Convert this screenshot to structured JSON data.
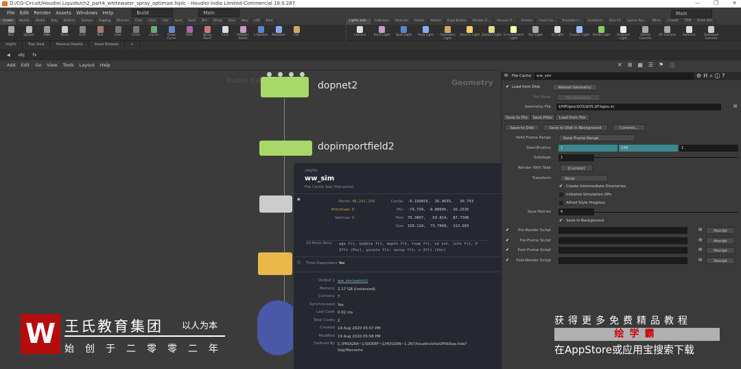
{
  "title": "D:/CG-Circuit/Houdini Liquids/ch2_part4_whitewater_spray_optimize.hiplc - Houdini Indie Limited-Commercial 18.0.287",
  "window_controls": [
    "—",
    "❐",
    "✕"
  ],
  "menu": [
    "File",
    "Edit",
    "Render",
    "Assets",
    "Windows",
    "Help"
  ],
  "desktop": "Build",
  "desktop2": "Main",
  "desktop_right": "Main",
  "shelf_left": {
    "tabs": [
      "Create",
      "Modify",
      "Model",
      "Poly",
      "Deform",
      "Texture",
      "Rigging",
      "Muscles",
      "Char",
      "Cons",
      "Hair",
      "Guid",
      "Guid",
      "Terr",
      "Simpl",
      "Clou",
      "Volu",
      "LOP",
      "Pant"
    ],
    "tools": [
      "Box",
      "Sphere",
      "Tube",
      "Torus",
      "Grid",
      "Null",
      "Line",
      "Circle",
      "Curve",
      "Draw Curve",
      "Path",
      "Spray Paint",
      "Font",
      "Platonic Solids",
      "L-System",
      "Metaball",
      "File"
    ]
  },
  "shelf_right": {
    "tabs": [
      "Lights and...",
      "Collisions",
      "Particles",
      "Grains",
      "Vellum",
      "Rigid Bodies",
      "Particle Fl...",
      "Viscous Fl...",
      "Oceans",
      "Fluid Con...",
      "Populate C...",
      "Container",
      "Pyro FX",
      "Sparse Pyr...",
      "Wires",
      "Crowds",
      "TEM",
      "Drive Sim"
    ],
    "tools": [
      "Camera",
      "Point Light",
      "Spot Light",
      "Area Light",
      "Geometry Light",
      "Volume Light",
      "Distant Light",
      "Environment Light",
      "Sky Light",
      "GI Light",
      "Caustic Light",
      "Portal Light",
      "Ambient Light",
      "Stereo Camera",
      "VR Camera",
      "Switcher",
      "Gamepad Camera"
    ]
  },
  "pane_tabs": [
    "/obj/fx",
    "Tree View",
    "Material Palette",
    "Asset Browser"
  ],
  "path": [
    "obj",
    "fx"
  ],
  "network_menu": [
    "Add",
    "Edit",
    "Go",
    "View",
    "Tools",
    "Layout",
    "Help"
  ],
  "network": {
    "watermark": "Indie Edition",
    "context": "Geometry",
    "nodes": [
      "dopnet2",
      "dopimportfield2"
    ]
  },
  "info": {
    "path": "/obj/fx/",
    "name": "ww_sim",
    "type": "File Cache Sop (filecache)",
    "points_label": "Points",
    "points": "48,241,260",
    "prims_label": "Primitives",
    "prims": "0",
    "verts_label": "Vertices",
    "verts": "0",
    "bbox": [
      {
        "label": "Center",
        "v": "-0.169655,  26.9635,   30.743"
      },
      {
        "label": "Min",
        "v": "-79.729, -9.88695, -26.2535"
      },
      {
        "label": "Max",
        "v": "79.3897,   63.814,  87.7396"
      },
      {
        "label": "Size",
        "v": "159.119,  73.7099,  113.993"
      }
    ],
    "attrs_label": "10 Point Attrs",
    "attrs": "age flt, bubble flt, depth flt, foam flt, id int, life flt, P 3flt (Pos), pscale flt, spray flt, v 3flt (Vec)",
    "time_dep_label": "Time Dependent",
    "time_dep": "Yes",
    "details": [
      {
        "k": "Output 1",
        "v": "ww_sim/switch1"
      },
      {
        "k": "Memory",
        "v": "2.17 GB (Instanced)"
      },
      {
        "k": "Contains",
        "v": "7"
      },
      {
        "k": "Synchronized",
        "v": "Yes"
      },
      {
        "k": "Last Cook",
        "v": "0.02 ms"
      },
      {
        "k": "Total Cooks",
        "v": "2"
      },
      {
        "k": "Created",
        "v": "19 Aug 2020 05:57 PM"
      },
      {
        "k": "Modified",
        "v": "19 Aug 2020 05:58 PM"
      },
      {
        "k": "Defined By",
        "v": "C:/PROGRA~1/SIDEEF~1/HOUDIN~1.287/houdini/otls/OPlibSop.hda?Sop/filecache"
      }
    ]
  },
  "params": {
    "node_type": "File Cache",
    "node_name": "ww_sim",
    "load_from_disk": "Load from Disk",
    "reload": "Reload Geometry",
    "file_mode_label": "File Mode",
    "file_mode": "No Operation",
    "geo_file_label": "Geometry File",
    "geo_file": "$HIP/geo/$OS/$OS.$F.bgeo.sc",
    "tabs": [
      "Save to File",
      "Save Filter",
      "Load from File"
    ],
    "save_disk": "Save to Disk",
    "save_bg": "Save to Disk in Background",
    "controls": "Controls...",
    "valid_range_label": "Valid Frame Range",
    "valid_range": "Save Frame Range",
    "sei_label": "Start/End/Inc",
    "start": "1",
    "end": "246",
    "inc": "1",
    "substeps_label": "Substeps",
    "substeps": "1",
    "take_label": "Render With Take",
    "take": "(Current)",
    "transform_label": "Transform",
    "transform": "None",
    "create_dirs": "Create Intermediate Directories",
    "init_sim": "Initialize Simulation OPs",
    "alfred": "Alfred Style Progress",
    "retries_label": "Save Retries",
    "retries": "6",
    "save_bg_chk": "Save in Background",
    "scripts": [
      "Pre-Render Script",
      "Pre-Frame Script",
      "Post-Frame Script",
      "Post-Render Script"
    ],
    "script_lang": "Hscript"
  },
  "overlay": {
    "logo": "W",
    "brand": "王氏教育集团",
    "motto": "以人为本",
    "founded": "始创于二零零二年",
    "promo1": "获得更多免费精品教程",
    "promo_name": "绘学霸",
    "promo3": "在AppStore或应用宝搜索下载"
  }
}
